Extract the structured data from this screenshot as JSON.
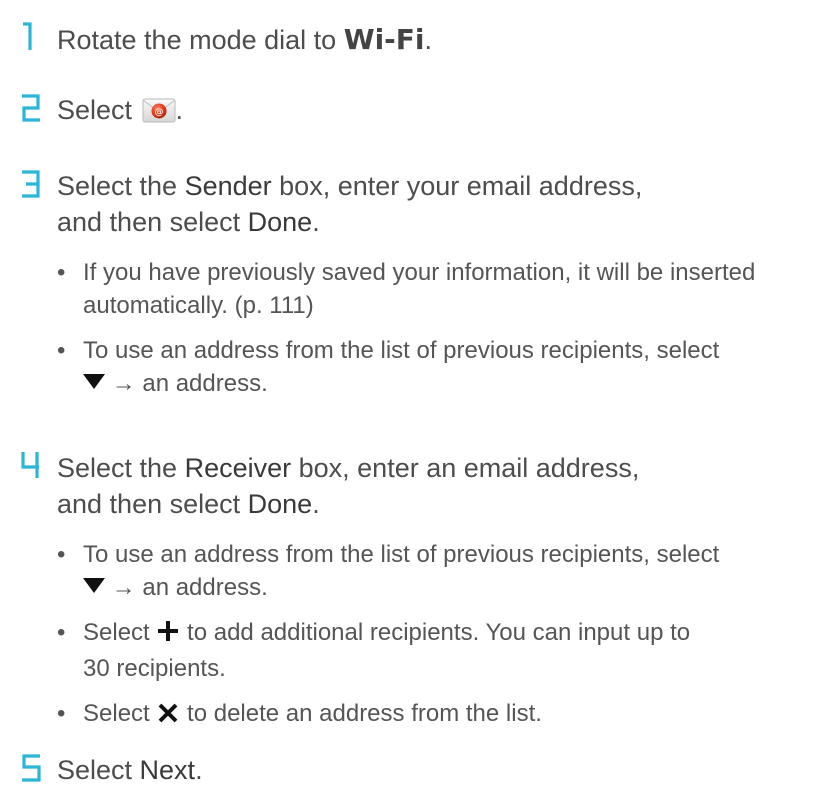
{
  "steps": [
    {
      "num": "1",
      "before": "Rotate the mode dial to ",
      "mode": "Wi-Fi",
      "after": "."
    },
    {
      "num": "2",
      "before": "Select ",
      "after": ".",
      "icon": "email-icon"
    },
    {
      "num": "3",
      "line1_a": "Select the ",
      "line1_kw": "Sender",
      "line1_b": " box, enter your email address,",
      "line2_a": "and then select ",
      "line2_kw": "Done",
      "line2_b": "."
    },
    {
      "num": "4",
      "line1_a": "Select the ",
      "line1_kw": "Receiver",
      "line1_b": " box, enter an email address,",
      "line2_a": "and then select ",
      "line2_kw": "Done",
      "line2_b": "."
    },
    {
      "num": "5",
      "before": "Select ",
      "kw": "Next",
      "after": "."
    }
  ],
  "step3_bullets": {
    "b1_line1": "If you have previously saved your information, it will be inserted",
    "b1_line2": "automatically. (p. 111)",
    "b2_line1": "To use an address from the list of previous recipients, select",
    "b2_line2": "→ an address."
  },
  "step4_bullets": {
    "b1_line1": "To use an address from the list of previous recipients, select",
    "b1_line2": "→ an address.",
    "b2_before": "Select ",
    "b2_after": " to add additional recipients. You can input up to",
    "b2_line2": "30 recipients.",
    "b3_before": "Select ",
    "b3_after": " to delete an address from the list."
  },
  "bullet_char": "•",
  "colors": {
    "numeral": "#2bb5d6",
    "text": "#4d4d4d",
    "icon_dark": "#111111"
  }
}
